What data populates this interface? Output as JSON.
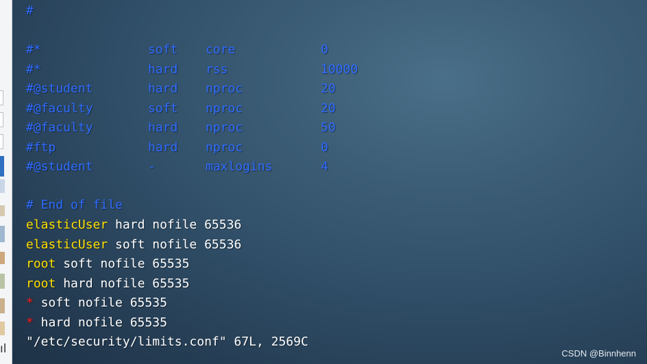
{
  "colors": {
    "comment": "#2f6bff",
    "user": "#ffe000",
    "wildcard": "#ff1a1a",
    "text": "#ffffff",
    "background": "#2f4d66"
  },
  "sidebar": {
    "letter": "ıl"
  },
  "terminal": {
    "header_comment": "#",
    "table_rows": [
      [
        "#*",
        "soft",
        "core",
        "0"
      ],
      [
        "#*",
        "hard",
        "rss",
        "10000"
      ],
      [
        "#@student",
        "hard",
        "nproc",
        "20"
      ],
      [
        "#@faculty",
        "soft",
        "nproc",
        "20"
      ],
      [
        "#@faculty",
        "hard",
        "nproc",
        "50"
      ],
      [
        "#ftp",
        "hard",
        "nproc",
        "0"
      ],
      [
        "#@student",
        "-",
        "maxlogins",
        "4"
      ]
    ],
    "end_comment": "# End of file",
    "entries": [
      {
        "user": "elasticUser",
        "rest": " hard nofile 65536"
      },
      {
        "user": "elasticUser",
        "rest": " soft nofile 65536"
      },
      {
        "user": "root",
        "rest": " soft nofile 65535"
      },
      {
        "user": "root",
        "rest": " hard nofile 65535"
      },
      {
        "user": "*",
        "rest": " soft nofile 65535"
      },
      {
        "user": "*",
        "rest": " hard nofile 65535"
      }
    ],
    "status": "\"/etc/security/limits.conf\" 67L, 2569C"
  },
  "watermark": "CSDN @Binnhenn"
}
